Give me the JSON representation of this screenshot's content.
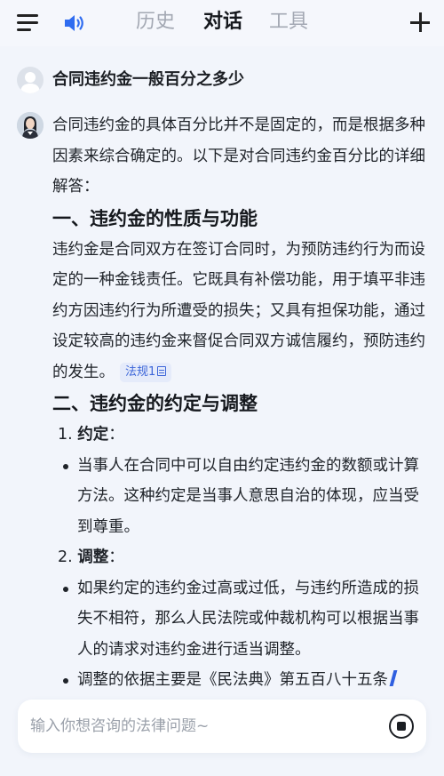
{
  "header": {
    "tabs": [
      {
        "label": "历史",
        "active": false
      },
      {
        "label": "对话",
        "active": true
      },
      {
        "label": "工具",
        "active": false
      }
    ]
  },
  "question": "合同违约金一般百分之多少",
  "answer": {
    "intro": "合同违约金的具体百分比并不是固定的，而是根据多种因素来综合确定的。以下是对合同违约金百分比的详细解答：",
    "section1_title": "一、违约金的性质与功能",
    "section1_text": "违约金是合同双方在签订合同时，为预防违约行为而设定的一种金钱责任。它既具有补偿功能，用于填平非违约方因违约行为所遭受的损失；又具有担保功能，通过设定较高的违约金来督促合同双方诚信履约，预防违约的发生。",
    "citation": "法规1",
    "section2_title": "二、违约金的约定与调整",
    "item1_num": "1.",
    "item1_title": "约定",
    "item1_colon": "：",
    "item1_bullet1": "当事人在合同中可以自由约定违约金的数额或计算方法。这种约定是当事人意思自治的体现，应当受到尊重。",
    "item2_num": "2.",
    "item2_title": "调整",
    "item2_colon": "：",
    "item2_bullet1": "如果约定的违约金过高或过低，与违约所造成的损失不相符，那么人民法院或仲裁机构可以根据当事人的请求对违约金进行适当调整。",
    "item2_bullet2": "调整的依据主要是《民法典》第五百八十五条"
  },
  "input": {
    "placeholder": "输入你想咨询的法律问题~",
    "value": ""
  },
  "colors": {
    "accent": "#3d66d9",
    "background": "#f2f5fb"
  },
  "icons": {
    "menu": "menu-icon",
    "speaker": "speaker-icon",
    "plus": "plus-icon",
    "stop": "stop-icon",
    "citation": "document-icon"
  }
}
